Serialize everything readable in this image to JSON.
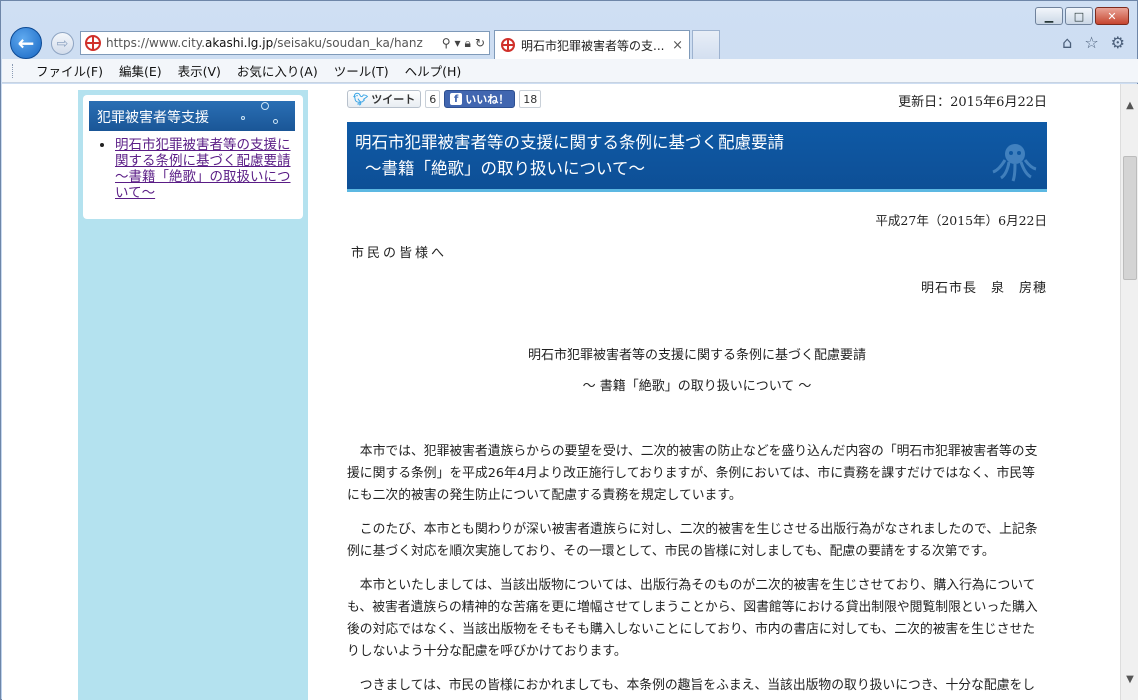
{
  "browser": {
    "url_prefix": "https://www.city.",
    "url_domain": "akashi.lg.jp",
    "url_rest": "/seisaku/soudan_ka/hanz",
    "tab_title": "明石市犯罪被害者等の支...",
    "tab_close": "×",
    "window_controls": {
      "minimize": "▭",
      "maximize": "□",
      "close": "✕"
    }
  },
  "menu": [
    "ファイル(F)",
    "編集(E)",
    "表示(V)",
    "お気に入り(A)",
    "ツール(T)",
    "ヘルプ(H)"
  ],
  "sidebar": {
    "header": "犯罪被害者等支援",
    "items": [
      {
        "label": "明石市犯罪被害者等の支援に関する条例に基づく配慮要請～書籍「絶歌」の取扱いについて～"
      }
    ]
  },
  "social": {
    "tweet_label": "ツイート",
    "tweet_count": "6",
    "like_label": "いいね！",
    "like_count": "18"
  },
  "article": {
    "updated": "更新日：2015年6月22日",
    "title_line1": "明石市犯罪被害者等の支援に関する条例に基づく配慮要請",
    "title_line2": "～書籍「絶歌」の取り扱いについて～",
    "date": "平成27年（2015年）6月22日",
    "greeting": "市民の皆様へ",
    "sender": "明石市長　泉　房穂",
    "request_title": "明石市犯罪被害者等の支援に関する条例に基づく配慮要請",
    "request_subtitle": "～ 書籍「絶歌」の取り扱いについて ～",
    "paragraphs": [
      "本市では、犯罪被害者遺族らからの要望を受け、二次的被害の防止などを盛り込んだ内容の「明石市犯罪被害者等の支援に関する条例」を平成26年4月より改正施行しておりますが、条例においては、市に責務を課すだけではなく、市民等にも二次的被害の発生防止について配慮する責務を規定しています。",
      "このたび、本市とも関わりが深い被害者遺族らに対し、二次的被害を生じさせる出版行為がなされましたので、上記条例に基づく対応を順次実施しており、その一環として、市民の皆様に対しましても、配慮の要請をする次第です。",
      "本市といたしましては、当該出版物については、出版行為そのものが二次的被害を生じさせており、購入行為についても、被害者遺族らの精神的な苦痛を更に増幅させてしまうことから、図書館等における貸出制限や閲覧制限といった購入後の対応ではなく、当該出版物をそもそも購入しないことにしており、市内の書店に対しても、二次的被害を生じさせたりしないよう十分な配慮を呼びかけております。",
      "つきましては、市民の皆様におかれましても、本条例の趣旨をふまえ、当該出版物の取り扱いにつき、十分な配慮をし"
    ]
  }
}
